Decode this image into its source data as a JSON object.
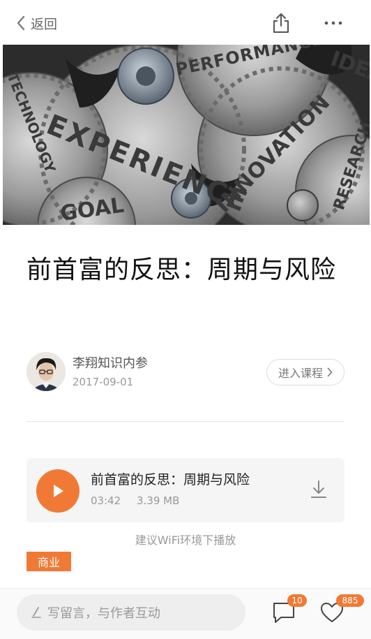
{
  "nav": {
    "back_label": "返回"
  },
  "hero": {
    "words": [
      "EXPERIENCE",
      "PERFORMANCE",
      "IDEA",
      "TECHNOLOGY",
      "INNOVATION",
      "RESEARCH",
      "GOAL"
    ]
  },
  "article": {
    "title": "前首富的反思：周期与风险",
    "author": "李翔知识内参",
    "date": "2017-09-01",
    "enter_course_label": "进入课程"
  },
  "audio": {
    "title": "前首富的反思：周期与风险",
    "duration": "03:42",
    "size": "3.39 MB",
    "wifi_hint": "建议WiFi环境下播放"
  },
  "tag": "商业",
  "bottom": {
    "comment_placeholder": "写留言，与作者互动",
    "comment_count": "10",
    "like_count": "885"
  },
  "colors": {
    "accent": "#f07a35"
  }
}
